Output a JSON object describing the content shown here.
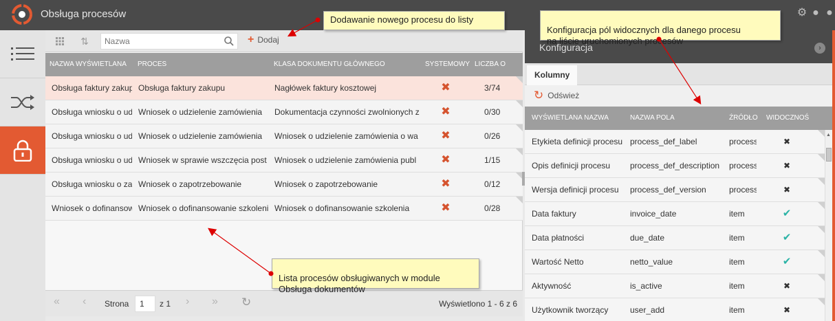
{
  "app": {
    "title": "Obsługa procesów"
  },
  "window_icons": [
    "gear-icon",
    "minimize-icon",
    "close-icon"
  ],
  "leftbar": {
    "items": [
      {
        "name": "list-icon",
        "active": false
      },
      {
        "name": "shuffle-icon",
        "active": false
      },
      {
        "name": "lock-icon",
        "active": true
      }
    ]
  },
  "toolbar": {
    "search_placeholder": "Nazwa",
    "add_label": "Dodaj"
  },
  "grid": {
    "columns": [
      "NAZWA WYŚWIETLANA",
      "PROCES",
      "KLASA DOKUMENTU GŁÓWNEGO",
      "SYSTEMOWY",
      "LICZBA O"
    ],
    "rows": [
      {
        "name": "Obsługa faktury zakupu",
        "process": "Obsługa faktury zakupu",
        "doc_class": "Nagłówek faktury kosztowej",
        "system": "✖",
        "count": "3/74"
      },
      {
        "name": "Obsługa wniosku o udzielenie zamówienia",
        "process": "Wniosek o udzielenie zamówienia",
        "doc_class": "Dokumentacja czynności zwolnionych z",
        "system": "✖",
        "count": "0/30"
      },
      {
        "name": "Obsługa wniosku o udzielenie zamówienia",
        "process": "Wniosek o udzielenie zamówienia",
        "doc_class": "Wniosek o udzielenie zamówienia o wa",
        "system": "✖",
        "count": "0/26"
      },
      {
        "name": "Obsługa wniosku o udzielenie",
        "process": "Wniosek w sprawie wszczęcia post",
        "doc_class": "Wniosek o udzielenie zamówienia publ",
        "system": "✖",
        "count": "1/15"
      },
      {
        "name": "Obsługa wniosku o zapotrzebowanie",
        "process": "Wniosek o zapotrzebowanie",
        "doc_class": "Wniosek o zapotrzebowanie",
        "system": "✖",
        "count": "0/12"
      },
      {
        "name": "Wniosek o dofinansowanie",
        "process": "Wniosek o dofinansowanie szkoleni",
        "doc_class": "Wniosek o dofinansowanie szkolenia",
        "system": "✖",
        "count": "0/28"
      }
    ]
  },
  "pager": {
    "page_label": "Strona",
    "page_value": "1",
    "of_label": "z 1",
    "info": "Wyświetlono 1 - 6 z 6"
  },
  "config": {
    "title": "Konfiguracja",
    "tab": "Kolumny",
    "refresh_label": "Odśwież",
    "columns": [
      "WYŚWIETLANA NAZWA",
      "NAZWA POLA",
      "ŹRÓDŁO",
      "WIDOCZNOŚ"
    ],
    "rows": [
      {
        "display": "Etykieta definicji procesu",
        "field": "process_def_label",
        "source": "process",
        "visible": "✖"
      },
      {
        "display": "Opis definicji procesu",
        "field": "process_def_description",
        "source": "process",
        "visible": "✖"
      },
      {
        "display": "Wersja definicji procesu",
        "field": "process_def_version",
        "source": "process",
        "visible": "✖"
      },
      {
        "display": "Data faktury",
        "field": "invoice_date",
        "source": "item",
        "visible": "✔"
      },
      {
        "display": "Data płatności",
        "field": "due_date",
        "source": "item",
        "visible": "✔"
      },
      {
        "display": "Wartość Netto",
        "field": "netto_value",
        "source": "item",
        "visible": "✔"
      },
      {
        "display": "Aktywność",
        "field": "is_active",
        "source": "item",
        "visible": "✖"
      },
      {
        "display": "Użytkownik tworzący",
        "field": "user_add",
        "source": "item",
        "visible": "✖"
      }
    ]
  },
  "callouts": {
    "add": "Dodawanie nowego procesu do listy",
    "config": "Konfiguracja pól widocznych dla danego procesu\nna liście uruchomionych procesów",
    "list": "Lista procesów obsługiwanych w module\nObsługa dokumentów"
  },
  "colors": {
    "accent": "#e35a32",
    "header_gray": "#9e9e9e",
    "titlebar": "#4a4a4a",
    "check": "#2bb3a6",
    "callout": "#fffbbd"
  }
}
